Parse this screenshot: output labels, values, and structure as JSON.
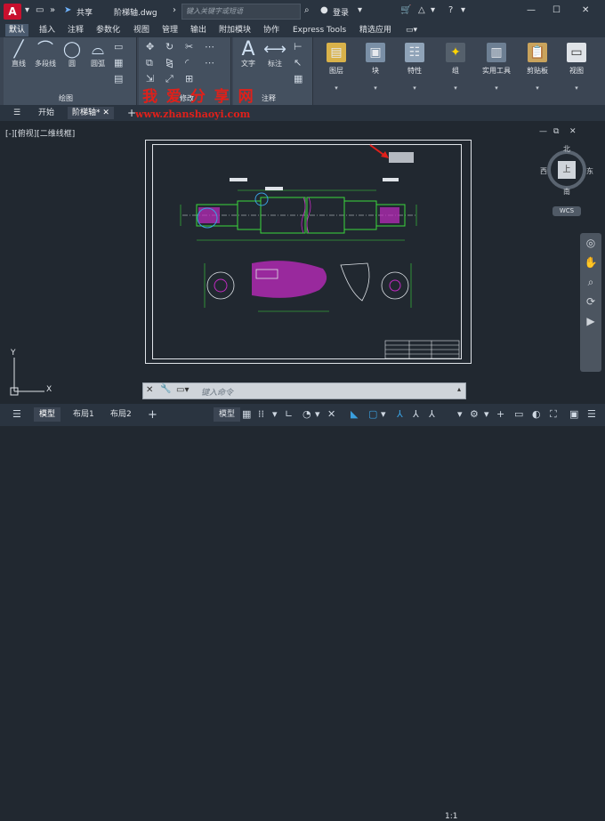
{
  "titlebar": {
    "app_logo": "A",
    "share_label": "共享",
    "doc_title": "阶梯轴.dwg",
    "search_placeholder": "键入关键字或短语",
    "signin_label": "登录"
  },
  "ribbon_tabs": [
    "默认",
    "插入",
    "注释",
    "参数化",
    "视图",
    "管理",
    "输出",
    "附加模块",
    "协作",
    "Express Tools",
    "精选应用"
  ],
  "ribbon": {
    "draw_tools": [
      "直线",
      "多段线",
      "圆",
      "圆弧"
    ],
    "draw_panel_title": "绘图",
    "modify_panel_title": "修改",
    "text_label": "文字",
    "dim_label": "标注",
    "annot_panel_title": "注释",
    "big_buttons": [
      "图层",
      "块",
      "特性",
      "组",
      "实用工具",
      "剪贴板",
      "视图"
    ]
  },
  "file_tabs": {
    "start_label": "开始",
    "drawing_label": "阶梯轴*"
  },
  "watermark": {
    "title": "我 爱 分 享 网",
    "url": "www.zhanshaoyi.com"
  },
  "viewport_label": "[-][俯视][二维线框]",
  "viewcube": {
    "top_face": "上",
    "north": "北",
    "south": "南",
    "west": "西",
    "east": "东",
    "wcs": "WCS"
  },
  "ucs": {
    "x": "X",
    "y": "Y"
  },
  "command": {
    "placeholder": "键入命令"
  },
  "statusbar": {
    "tabs": [
      "模型",
      "布局1",
      "布局2"
    ],
    "model_label": "模型",
    "scale": "1:1"
  },
  "colors": {
    "accent_red": "#c8102e",
    "drawing_green": "#3cd83c",
    "drawing_magenta": "#c22ac2",
    "background": "#212830"
  }
}
